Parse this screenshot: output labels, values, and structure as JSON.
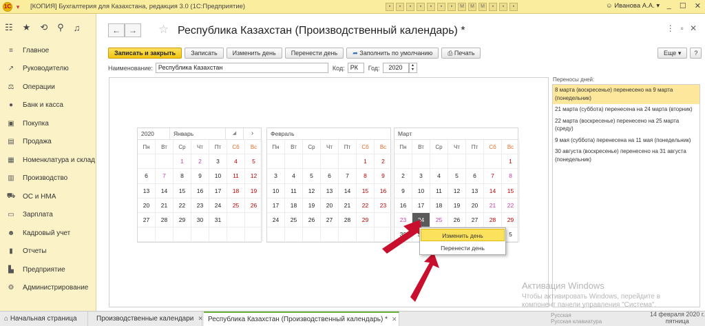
{
  "titlebar": {
    "logo": "1С",
    "title": "[КОПИЯ] Бухгалтерия для Казахстана, редакция 3.0  (1С:Предприятие)",
    "toolbar_icons": [
      "save-icon",
      "print-icon",
      "copy-icon",
      "add-icon",
      "minus-icon",
      "lock-icon",
      "calc-icon",
      "m-icon",
      "m-plus-icon",
      "m-minus-icon",
      "docs-icon",
      "bell-icon",
      "search-icon"
    ],
    "toolbar_icon_glyphs": [
      "▪",
      "▪",
      "▪",
      "▪",
      "▪",
      "▪",
      "▪",
      "M",
      "M",
      "M",
      "▪",
      "▪",
      "▪"
    ],
    "user": "Иванова А.А.",
    "win_controls": [
      "_",
      "☐",
      "✕"
    ]
  },
  "sidebar": {
    "top_icons": [
      "apps-grid-icon",
      "favorites-star-icon",
      "history-icon",
      "search-icon",
      "notifications-bell-icon"
    ],
    "top_glyphs": [
      "☷",
      "★",
      "⟲",
      "⚲",
      "♫"
    ],
    "items": [
      {
        "label": "Главное",
        "icon": "menu-lines-icon",
        "glyph": "≡"
      },
      {
        "label": "Руководителю",
        "icon": "trend-icon",
        "glyph": "↗"
      },
      {
        "label": "Операции",
        "icon": "operations-icon",
        "glyph": "⚖"
      },
      {
        "label": "Банк и касса",
        "icon": "bank-icon",
        "glyph": "●"
      },
      {
        "label": "Покупка",
        "icon": "cart-icon",
        "glyph": "▣"
      },
      {
        "label": "Продажа",
        "icon": "sales-icon",
        "glyph": "▤"
      },
      {
        "label": "Номенклатура и склад",
        "icon": "warehouse-icon",
        "glyph": "▦"
      },
      {
        "label": "Производство",
        "icon": "production-icon",
        "glyph": "▥"
      },
      {
        "label": "ОС и НМА",
        "icon": "assets-icon",
        "glyph": "⛟"
      },
      {
        "label": "Зарплата",
        "icon": "salary-icon",
        "glyph": "▭"
      },
      {
        "label": "Кадровый учет",
        "icon": "people-icon",
        "glyph": "☻"
      },
      {
        "label": "Отчеты",
        "icon": "reports-icon",
        "glyph": "▮"
      },
      {
        "label": "Предприятие",
        "icon": "enterprise-icon",
        "glyph": "▙"
      },
      {
        "label": "Администрирование",
        "icon": "settings-gear-icon",
        "glyph": "⚙"
      }
    ]
  },
  "form": {
    "back_glyph": "←",
    "forward_glyph": "→",
    "title": "Республика Казахстан (Производственный календарь) *",
    "win_controls": [
      "⋮",
      "▫",
      "✕"
    ],
    "toolbar": {
      "save_close": "Записать и закрыть",
      "save": "Записать",
      "change_day": "Изменить день",
      "move_day": "Перенести день",
      "fill_default": "Заполнить по умолчанию",
      "print": "Печать",
      "more": "Еще ▾",
      "help": "?"
    },
    "fields": {
      "name_label": "Наименование:",
      "name_value": "Республика Казахстан",
      "code_label": "Код:",
      "code_value": "РК",
      "year_label": "Год:",
      "year_value": "2020"
    }
  },
  "calendar": {
    "weekdays": [
      "Пн",
      "Вт",
      "Ср",
      "Чт",
      "Пт",
      "Сб",
      "Вс"
    ],
    "months": [
      {
        "year": "2020",
        "name": "Январь",
        "has_dropdown": true,
        "next_arrow": "›",
        "cells": [
          {
            "t": ""
          },
          {
            "t": ""
          },
          {
            "t": "1",
            "c": "pink"
          },
          {
            "t": "2",
            "c": "pink"
          },
          {
            "t": "3"
          },
          {
            "t": "4",
            "c": "red"
          },
          {
            "t": "5",
            "c": "red"
          },
          {
            "t": "6"
          },
          {
            "t": "7",
            "c": "pink"
          },
          {
            "t": "8"
          },
          {
            "t": "9"
          },
          {
            "t": "10"
          },
          {
            "t": "11",
            "c": "red"
          },
          {
            "t": "12",
            "c": "red"
          },
          {
            "t": "13"
          },
          {
            "t": "14"
          },
          {
            "t": "15"
          },
          {
            "t": "16"
          },
          {
            "t": "17"
          },
          {
            "t": "18",
            "c": "red"
          },
          {
            "t": "19",
            "c": "red"
          },
          {
            "t": "20"
          },
          {
            "t": "21"
          },
          {
            "t": "22"
          },
          {
            "t": "23"
          },
          {
            "t": "24"
          },
          {
            "t": "25",
            "c": "red"
          },
          {
            "t": "26",
            "c": "red"
          },
          {
            "t": "27"
          },
          {
            "t": "28"
          },
          {
            "t": "29"
          },
          {
            "t": "30"
          },
          {
            "t": "31"
          },
          {
            "t": ""
          },
          {
            "t": ""
          },
          {
            "t": ""
          },
          {
            "t": ""
          },
          {
            "t": ""
          },
          {
            "t": ""
          },
          {
            "t": ""
          },
          {
            "t": ""
          },
          {
            "t": ""
          }
        ]
      },
      {
        "year": "",
        "name": "Февраль",
        "has_dropdown": false,
        "next_arrow": "",
        "cells": [
          {
            "t": ""
          },
          {
            "t": ""
          },
          {
            "t": ""
          },
          {
            "t": ""
          },
          {
            "t": ""
          },
          {
            "t": "1",
            "c": "red"
          },
          {
            "t": "2",
            "c": "red"
          },
          {
            "t": "3"
          },
          {
            "t": "4"
          },
          {
            "t": "5"
          },
          {
            "t": "6"
          },
          {
            "t": "7"
          },
          {
            "t": "8",
            "c": "red"
          },
          {
            "t": "9",
            "c": "red"
          },
          {
            "t": "10"
          },
          {
            "t": "11"
          },
          {
            "t": "12"
          },
          {
            "t": "13"
          },
          {
            "t": "14"
          },
          {
            "t": "15",
            "c": "red"
          },
          {
            "t": "16",
            "c": "red"
          },
          {
            "t": "17"
          },
          {
            "t": "18"
          },
          {
            "t": "19"
          },
          {
            "t": "20"
          },
          {
            "t": "21"
          },
          {
            "t": "22",
            "c": "red"
          },
          {
            "t": "23",
            "c": "red"
          },
          {
            "t": "24"
          },
          {
            "t": "25"
          },
          {
            "t": "26"
          },
          {
            "t": "27"
          },
          {
            "t": "28"
          },
          {
            "t": "29",
            "c": "red"
          },
          {
            "t": ""
          },
          {
            "t": ""
          },
          {
            "t": ""
          },
          {
            "t": ""
          },
          {
            "t": ""
          },
          {
            "t": ""
          },
          {
            "t": ""
          },
          {
            "t": ""
          }
        ]
      },
      {
        "year": "",
        "name": "Март",
        "has_dropdown": false,
        "next_arrow": "",
        "cells": [
          {
            "t": ""
          },
          {
            "t": ""
          },
          {
            "t": ""
          },
          {
            "t": ""
          },
          {
            "t": ""
          },
          {
            "t": ""
          },
          {
            "t": "1",
            "c": "red"
          },
          {
            "t": "2"
          },
          {
            "t": "3"
          },
          {
            "t": "4"
          },
          {
            "t": "5"
          },
          {
            "t": "6"
          },
          {
            "t": "7",
            "c": "red"
          },
          {
            "t": "8",
            "c": "pink"
          },
          {
            "t": "9"
          },
          {
            "t": "10"
          },
          {
            "t": "11"
          },
          {
            "t": "12"
          },
          {
            "t": "13"
          },
          {
            "t": "14",
            "c": "red"
          },
          {
            "t": "15",
            "c": "red"
          },
          {
            "t": "16"
          },
          {
            "t": "17"
          },
          {
            "t": "18"
          },
          {
            "t": "19"
          },
          {
            "t": "20"
          },
          {
            "t": "21",
            "c": "pink"
          },
          {
            "t": "22",
            "c": "pink"
          },
          {
            "t": "23",
            "c": "pink"
          },
          {
            "t": "24",
            "c": "sel"
          },
          {
            "t": "25",
            "c": "pink"
          },
          {
            "t": "26"
          },
          {
            "t": "27"
          },
          {
            "t": "28",
            "c": "red"
          },
          {
            "t": "29",
            "c": "red"
          },
          {
            "t": "30"
          },
          {
            "t": "31"
          },
          {
            "t": ""
          },
          {
            "t": ""
          },
          {
            "t": ""
          },
          {
            "t": ""
          },
          {
            "t": "5"
          }
        ]
      }
    ]
  },
  "context_menu": {
    "items": [
      "Изменить день",
      "Перенести день"
    ]
  },
  "transfers": {
    "label": "Переносы дней:",
    "items": [
      "8 марта (воскресенье) перенесено на 9 марта (понедельник)",
      "21 марта (суббота) перенесена на 24 марта (вторник)",
      "22 марта (воскресенье) перенесено на 25 марта (среду)",
      "9 мая (суббота) перенесена на 11 мая (понедельник)",
      "30 августа (воскресенье) перенесено на 31 августа (понедельник)"
    ]
  },
  "tabs": {
    "home": "Начальная страница",
    "calendars": "Производственные календари",
    "current": "Республика Казахстан (Производственный календарь) *",
    "close_glyph": "✕"
  },
  "watermark": {
    "title": "Активация Windows",
    "line1": "Чтобы активировать Windows, перейдите в",
    "line2": "компонент панели управления \"Система\"."
  },
  "taskbar": {
    "lang1": "Русская",
    "lang2": "Русская клавиатура",
    "date": "14 февраля 2020 г.",
    "weekday": "пятница"
  },
  "colors": {
    "accent_yellow": "#f1c40f",
    "arrow_red": "#c8102e",
    "holiday_red": "#c00000",
    "transferred_pink": "#c73fae"
  }
}
